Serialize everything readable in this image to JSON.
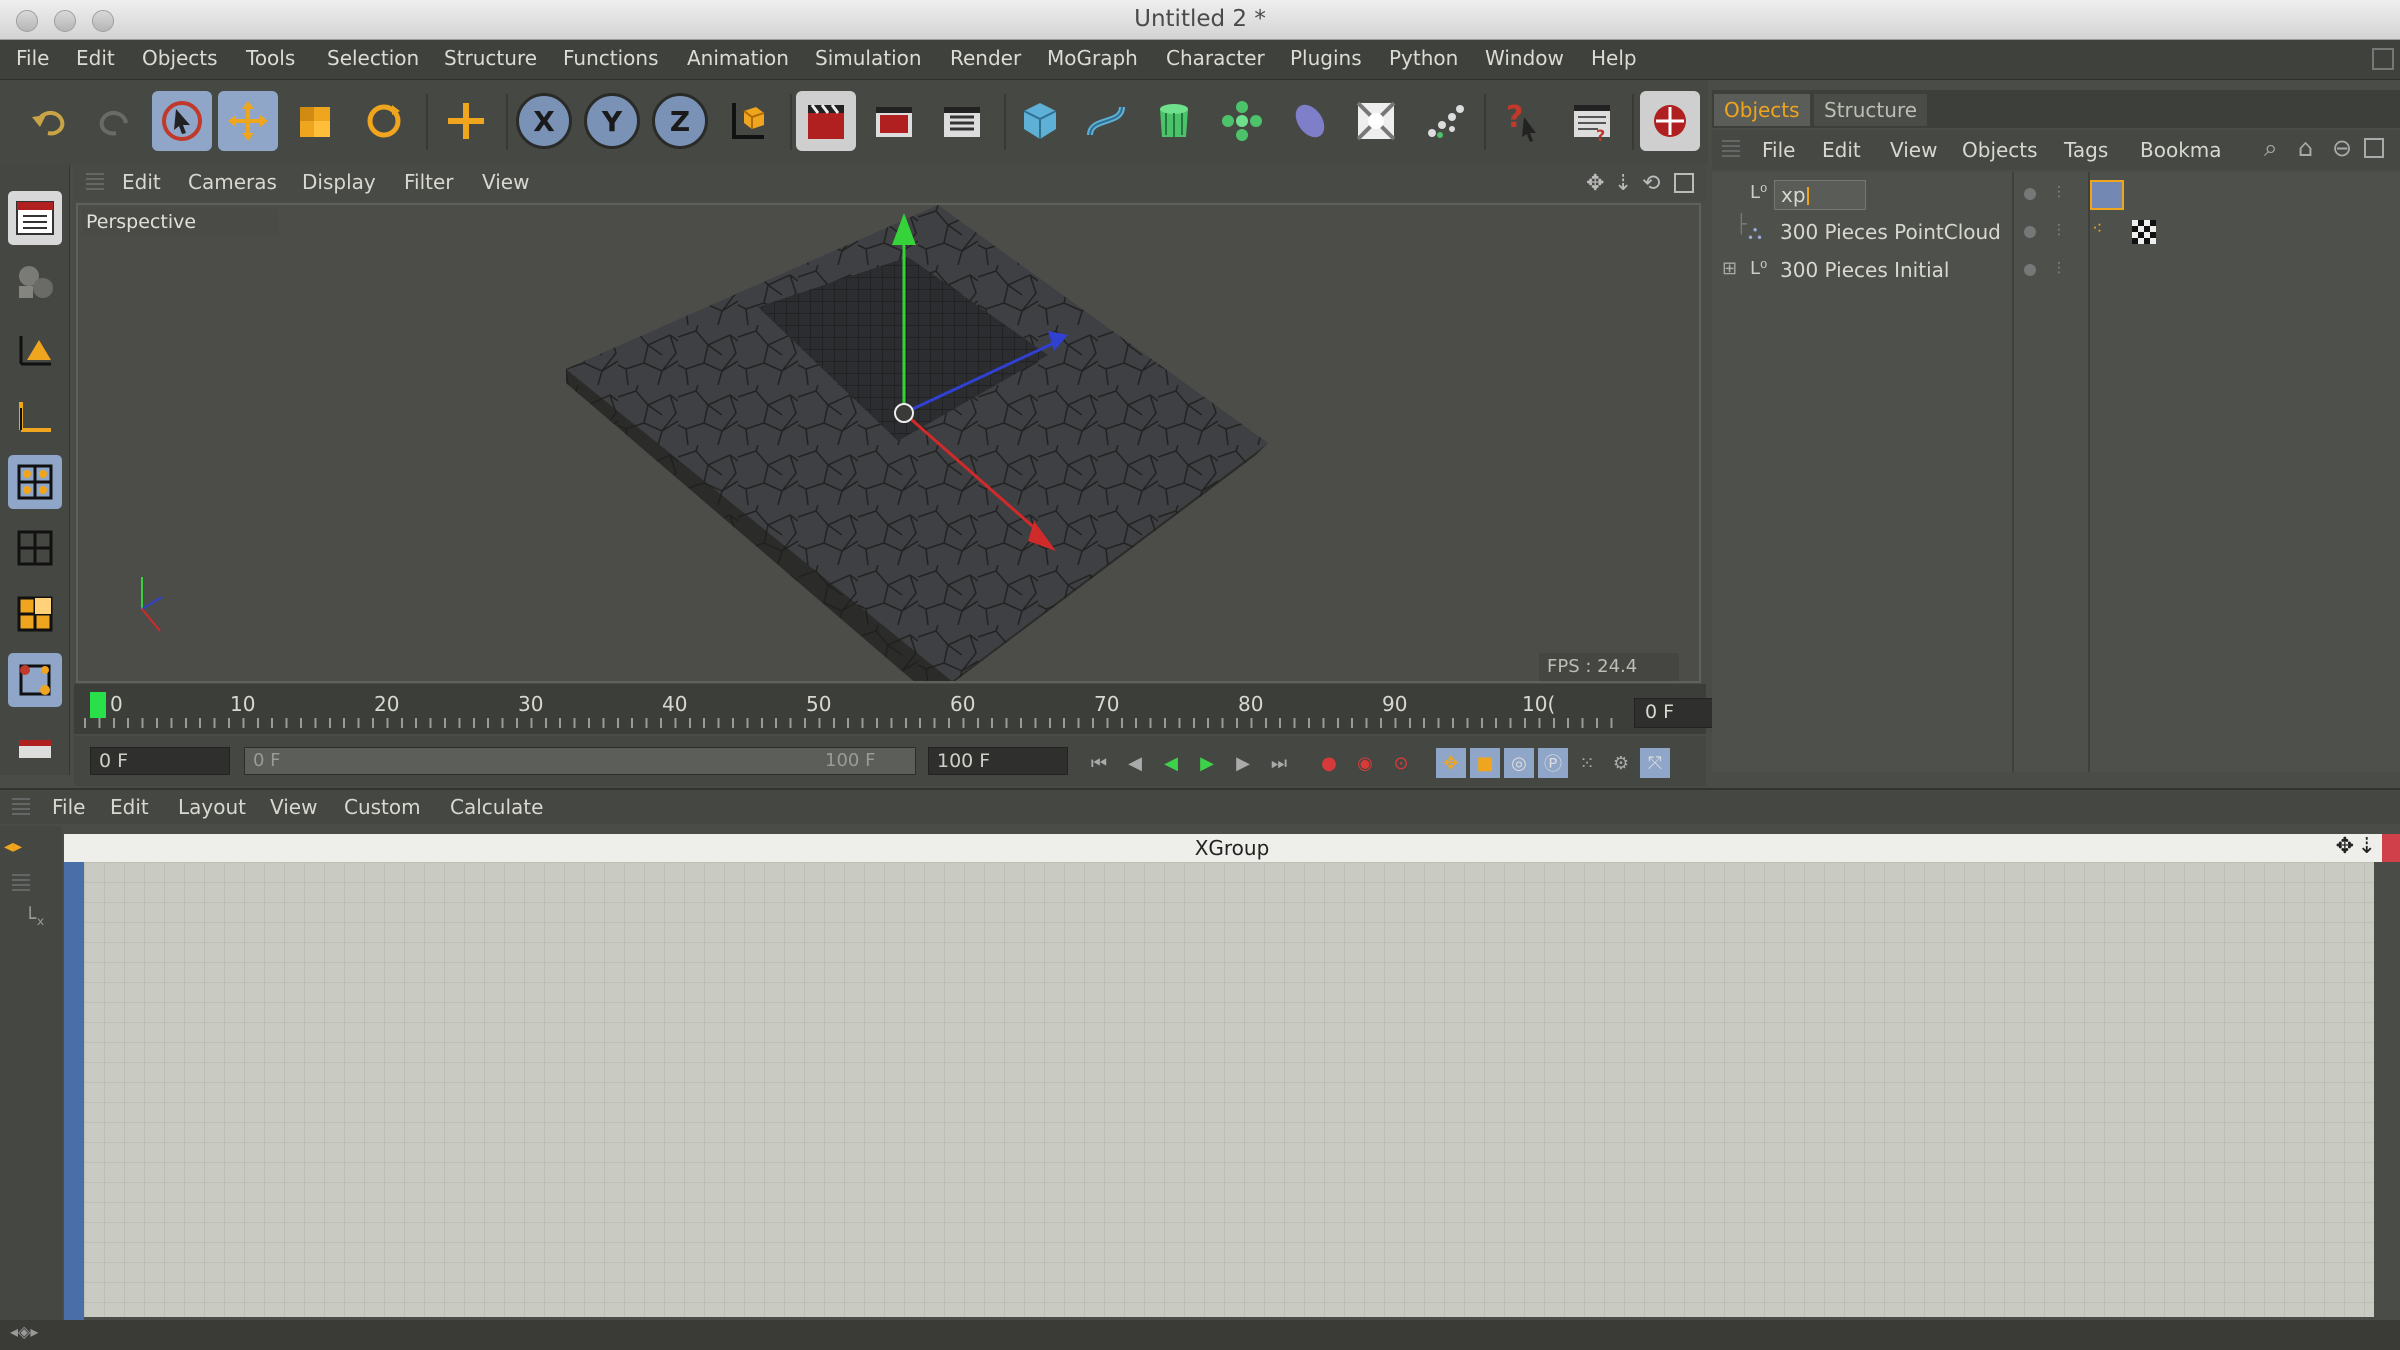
{
  "window": {
    "title": "Untitled 2 *"
  },
  "menubar": [
    "File",
    "Edit",
    "Objects",
    "Tools",
    "Selection",
    "Structure",
    "Functions",
    "Animation",
    "Simulation",
    "Render",
    "MoGraph",
    "Character",
    "Plugins",
    "Python",
    "Window",
    "Help"
  ],
  "toolbar": {
    "axis_x": "X",
    "axis_y": "Y",
    "axis_z": "Z",
    "icons": [
      "undo-icon",
      "redo-icon",
      "live-selection-icon",
      "move-icon",
      "scale-icon",
      "rotate-icon",
      "world-axis-icon",
      "lock-x-icon",
      "lock-y-icon",
      "lock-z-icon",
      "coordinate-system-icon",
      "render-view-icon",
      "render-picture-viewer-icon",
      "render-settings-icon",
      "cube-icon",
      "spline-icon",
      "nurbs-icon",
      "array-icon",
      "deformer-icon",
      "scene-icon",
      "particles-icon",
      "help-icon",
      "timeline-icon",
      "picture-viewer-icon"
    ]
  },
  "viewport": {
    "menu": [
      "Edit",
      "Cameras",
      "Display",
      "Filter",
      "View"
    ],
    "label": "Perspective",
    "fps": "FPS : 24.4"
  },
  "timeline": {
    "ticks": [
      "0",
      "10",
      "20",
      "30",
      "40",
      "50",
      "60",
      "70",
      "80",
      "90",
      "10("
    ],
    "current_frame": "0 F"
  },
  "transport": {
    "start_field": "0 F",
    "range_start": "0 F",
    "range_end": "100 F",
    "end_field": "100 F"
  },
  "object_manager": {
    "tabs": [
      "Objects",
      "Structure"
    ],
    "active_tab": "Objects",
    "menu": [
      "File",
      "Edit",
      "View",
      "Objects",
      "Tags",
      "Bookma"
    ],
    "rows": [
      {
        "name": "xp",
        "editing": true
      },
      {
        "name": "300 Pieces PointCloud"
      },
      {
        "name": "300 Pieces Initial"
      }
    ]
  },
  "xpresso": {
    "menu": [
      "File",
      "Edit",
      "Layout",
      "View",
      "Custom",
      "Calculate"
    ],
    "title": "XGroup"
  },
  "colors": {
    "accent_orange": "#f0a51e",
    "active_blue": "#8fa6c8",
    "panel_bg": "#4a4c48",
    "grid_bg": "#c9cbc3"
  }
}
